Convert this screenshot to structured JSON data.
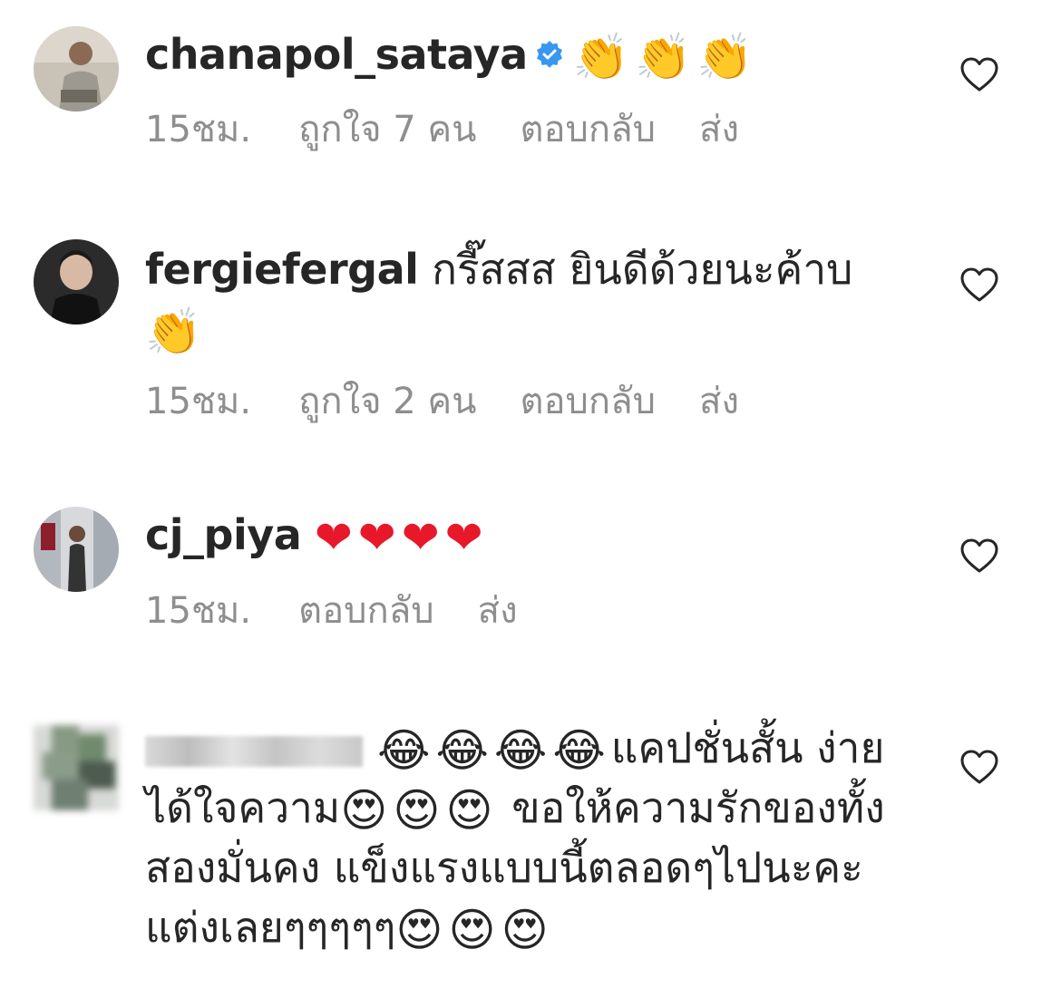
{
  "comments": [
    {
      "username": "chanapol_sataya",
      "verified": true,
      "text": "",
      "emojis": [
        "👏",
        "👏",
        "👏"
      ],
      "time": "15ชม.",
      "likes": "ถูกใจ 7 คน",
      "reply": "ตอบกลับ",
      "send": "ส่ง"
    },
    {
      "username": "fergiefergal",
      "verified": false,
      "text": "กรี๊สสส ยินดีด้วยนะค้าบ",
      "emojis": [
        "👏"
      ],
      "time": "15ชม.",
      "likes": "ถูกใจ 2 คน",
      "reply": "ตอบกลับ",
      "send": "ส่ง"
    },
    {
      "username": "cj_piya",
      "verified": false,
      "text": "",
      "emojis": [
        "❤",
        "❤",
        "❤",
        "❤"
      ],
      "time": "15ชม.",
      "likes": "",
      "reply": "ตอบกลับ",
      "send": "ส่ง"
    },
    {
      "username": "",
      "verified": false,
      "emojis_lead": [
        "😂",
        "😂",
        "😂",
        "😂"
      ],
      "text_1": "แคปชั่นสั้น ง่ายได้ใจความ",
      "emojis_mid": [
        "😍",
        "😍",
        "😍"
      ],
      "text_2": "ขอให้ความรักของทั้งสองมั่นคง แข็งแรงแบบนี้ตลอดๆไปนะคะ แต่งเลยๆๆๆๆๆ",
      "emojis_end": [
        "😍",
        "😍",
        "😍"
      ]
    }
  ],
  "icons": {
    "like": "heart-outline-icon",
    "verified": "verified-badge-icon"
  },
  "colors": {
    "text": "#262626",
    "meta": "#8e8e8e",
    "verified": "#3897f0",
    "heart": "#e8182b"
  }
}
